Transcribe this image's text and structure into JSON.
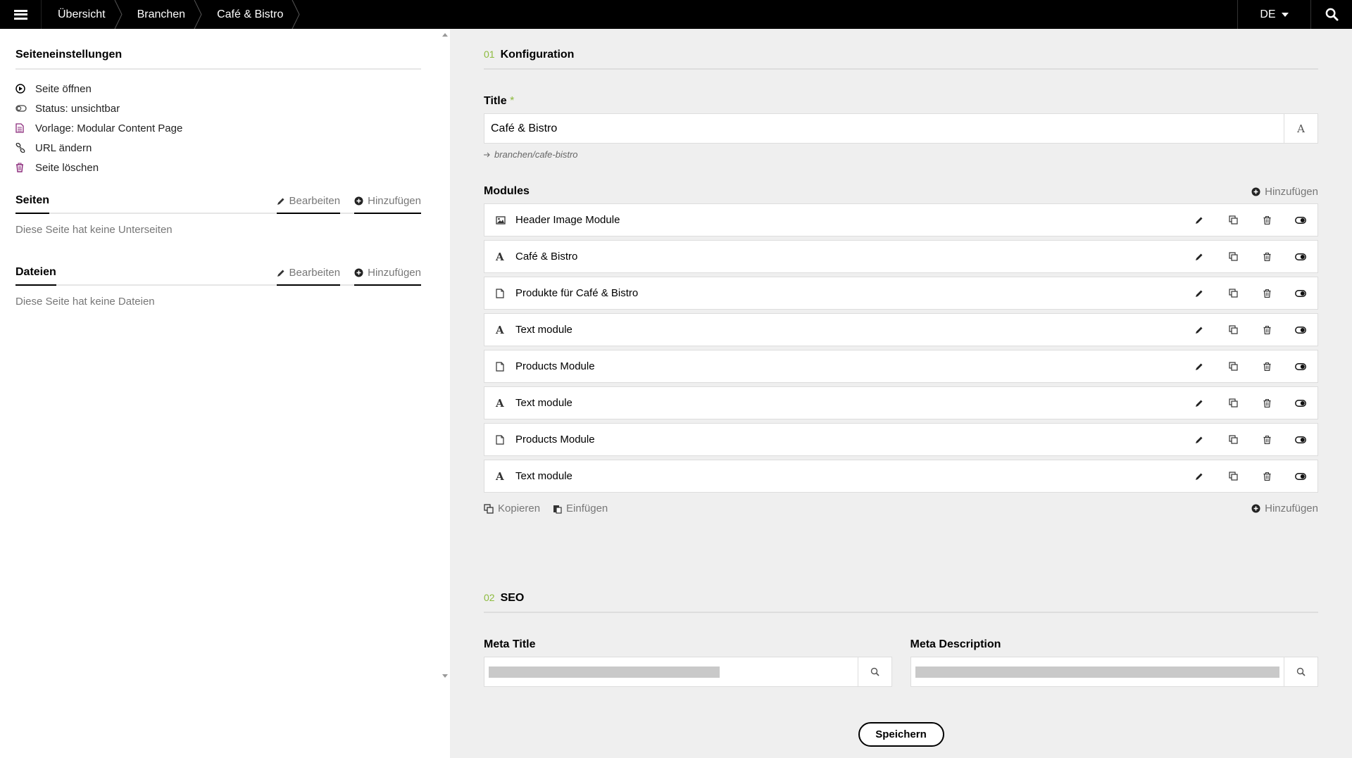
{
  "topbar": {
    "breadcrumbs": [
      "Übersicht",
      "Branchen",
      "Café & Bistro"
    ],
    "language": "DE"
  },
  "sidebar": {
    "settings_title": "Seiteneinstellungen",
    "settings_items": [
      {
        "label": "Seite öffnen",
        "icon": "open-icon"
      },
      {
        "label": "Status: unsichtbar",
        "icon": "toggle-icon"
      },
      {
        "label": "Vorlage: Modular Content Page",
        "icon": "template-icon"
      },
      {
        "label": "URL ändern",
        "icon": "link-icon"
      },
      {
        "label": "Seite löschen",
        "icon": "trash-icon"
      }
    ],
    "pages": {
      "title": "Seiten",
      "edit_label": "Bearbeiten",
      "add_label": "Hinzufügen",
      "empty": "Diese Seite hat keine Unterseiten"
    },
    "files": {
      "title": "Dateien",
      "edit_label": "Bearbeiten",
      "add_label": "Hinzufügen",
      "empty": "Diese Seite hat keine Dateien"
    }
  },
  "main": {
    "section1": {
      "num": "01",
      "title": "Konfiguration"
    },
    "title_field": {
      "label": "Title",
      "required_mark": "*",
      "value": "Café & Bistro",
      "url_hint": "branchen/cafe-bistro"
    },
    "modules": {
      "label": "Modules",
      "add_label": "Hinzufügen",
      "items": [
        {
          "label": "Header Image Module",
          "icon": "image-icon"
        },
        {
          "label": "Café & Bistro",
          "icon": "text-icon"
        },
        {
          "label": "Produkte für Café & Bistro",
          "icon": "document-icon"
        },
        {
          "label": "Text module",
          "icon": "text-icon"
        },
        {
          "label": "Products Module",
          "icon": "document-icon"
        },
        {
          "label": "Text module",
          "icon": "text-icon"
        },
        {
          "label": "Products Module",
          "icon": "document-icon"
        },
        {
          "label": "Text module",
          "icon": "text-icon"
        }
      ],
      "copy_label": "Kopieren",
      "paste_label": "Einfügen",
      "add_bottom_label": "Hinzufügen"
    },
    "section2": {
      "num": "02",
      "title": "SEO"
    },
    "meta_title": {
      "label": "Meta Title"
    },
    "meta_description": {
      "label": "Meta Description"
    },
    "save_label": "Speichern"
  },
  "colors": {
    "accent": "#8dbb3e",
    "icon_purple": "#8b2a7b",
    "bg_main": "#efefef",
    "topbar": "#000000"
  }
}
